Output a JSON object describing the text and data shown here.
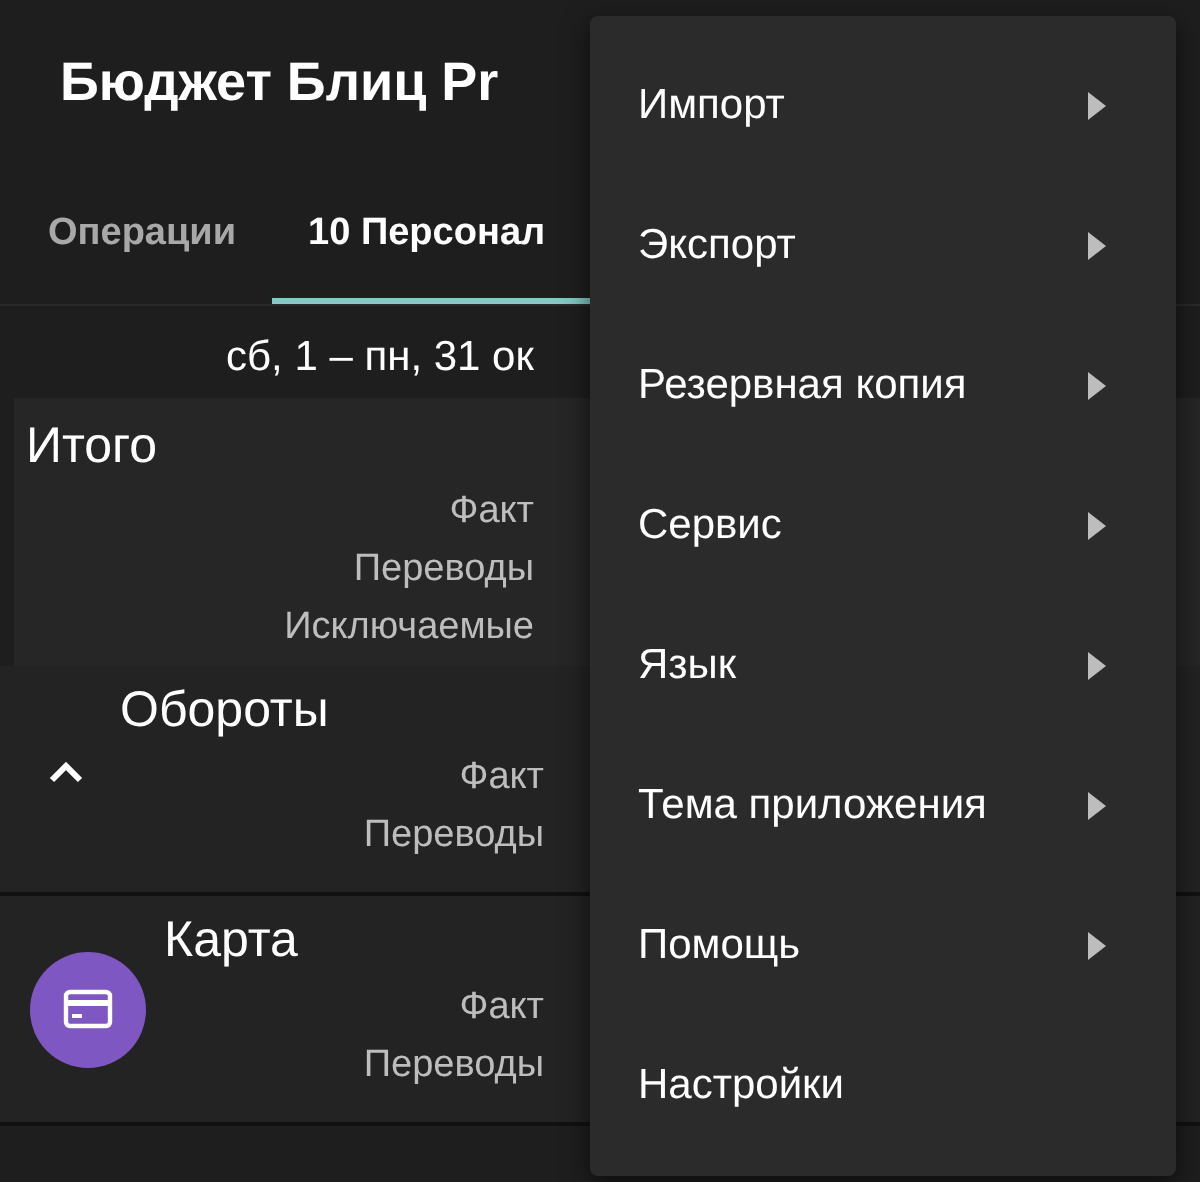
{
  "app_bar": {
    "title": "Бюджет Блиц Pr"
  },
  "tabs": [
    {
      "label": "Операции",
      "selected": false
    },
    {
      "label": "10 Персонал",
      "selected": true
    }
  ],
  "period": "сб, 1 – пн, 31 ок",
  "summary": {
    "title": "Итого",
    "lines": [
      "Факт",
      "Переводы",
      "Исключаемые"
    ]
  },
  "groups": [
    {
      "kind": "section",
      "title": "Обороты",
      "expanded": true,
      "lines": [
        "Факт",
        "Переводы"
      ]
    },
    {
      "kind": "account",
      "title": "Карта",
      "lines": [
        "Факт",
        "Переводы"
      ]
    }
  ],
  "menu": [
    {
      "label": "Импорт",
      "submenu": true
    },
    {
      "label": "Экспорт",
      "submenu": true
    },
    {
      "label": "Резервная копия",
      "submenu": true
    },
    {
      "label": "Сервис",
      "submenu": true
    },
    {
      "label": "Язык",
      "submenu": true
    },
    {
      "label": "Тема приложения",
      "submenu": true
    },
    {
      "label": "Помощь",
      "submenu": true
    },
    {
      "label": "Настройки",
      "submenu": false
    }
  ]
}
